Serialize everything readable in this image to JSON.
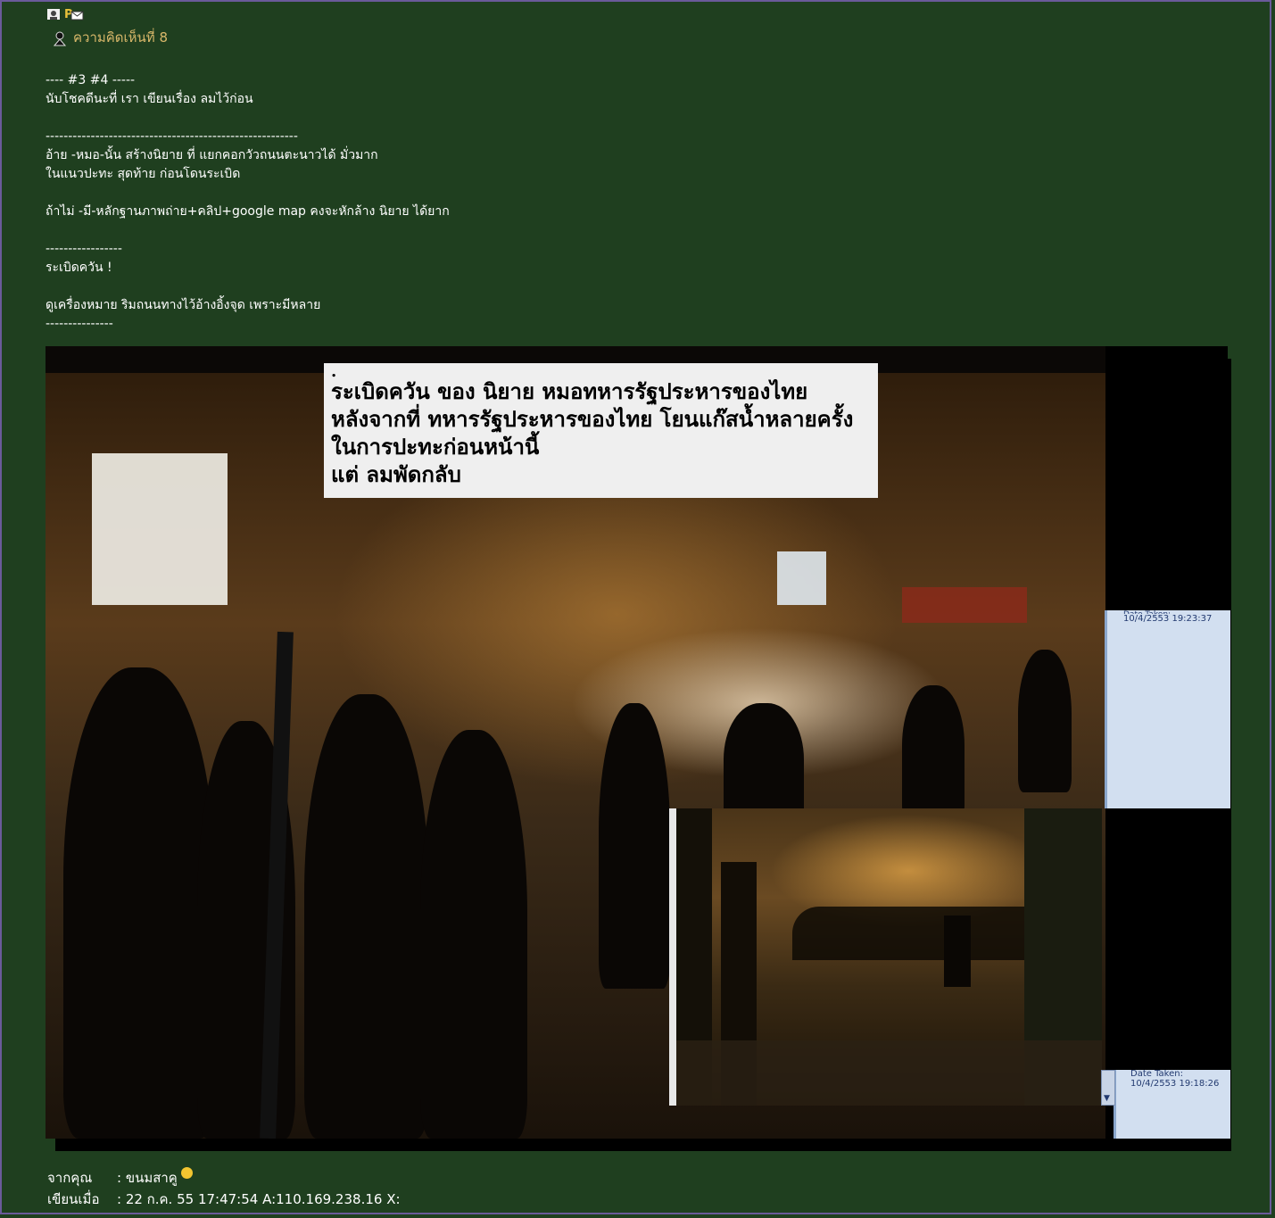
{
  "comment": {
    "title": "ความคิดเห็นที่ 8",
    "body": "---- #3 #4 -----\nนับโชคดีนะที่ เรา เขียนเรื่อง ลมไว้ก่อน\n\n--------------------------------------------------------\nอ้าย -หมอ-นั้น สร้างนิยาย ที่ แยกคอกวัวถนนตะนาวได้ มั่วมาก\nในแนวปะทะ สุดท้าย ก่อนโดนระเบิด\n\nถ้าไม่ -มี-หลักฐานภาพถ่าย+คลิป+google map คงจะหักล้าง นิยาย ได้ยาก\n\n-----------------\nระเบิดควัน !\n\nดูเครื่องหมาย ริมถนนทางไว้อ้างอิ้งจุด เพราะมีหลาย\n---------------"
  },
  "photo": {
    "caption_dot": ".",
    "caption_lines": [
      "ระเบิดควัน ของ นิยาย หมอทหารรัฐประหารของไทย",
      "หลังจากที่ ทหารรัฐประหารของไทย โยนแก๊สน้ำหลายครั้ง",
      "ในการปะทะก่อนหน้านี้",
      "แต่ ลมพัดกลับ"
    ],
    "panel1_label": "Date Taken:",
    "panel1_date": "10/4/2553 19:23:37",
    "panel2_label": "Date Taken:",
    "panel2_date": "10/4/2553 19:18:26"
  },
  "meta": {
    "from_label": "จากคุณ",
    "from_value": ": ขนมสาคู",
    "posted_label": "เขียนเมื่อ",
    "posted_value": ": 22 ก.ค. 55 17:47:54 A:110.169.238.16 X:"
  },
  "icons": [
    "user-icon",
    "message-icon",
    "avatar-icon",
    "smiley-icon"
  ]
}
